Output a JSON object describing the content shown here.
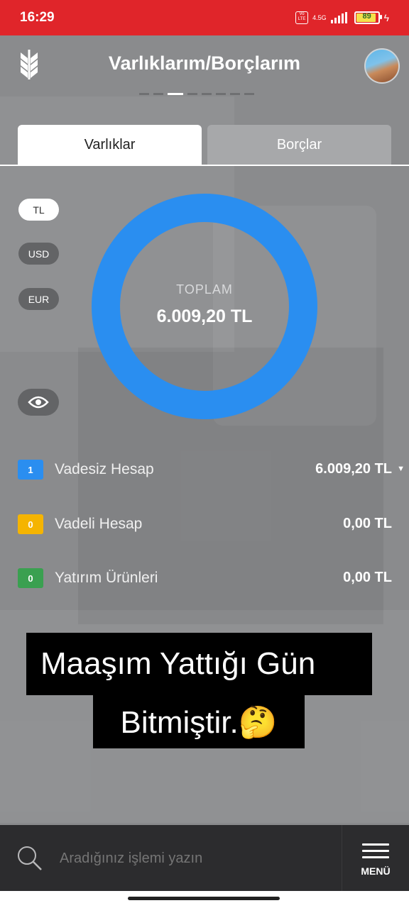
{
  "status_bar": {
    "time": "16:29",
    "network": "4.5G",
    "volte": "VoLTE",
    "battery": "89"
  },
  "header": {
    "title": "Varlıklarım/Borçlarım",
    "pager_count": 8,
    "pager_active": 2
  },
  "tabs": [
    {
      "label": "Varlıklar",
      "active": true
    },
    {
      "label": "Borçlar",
      "active": false
    }
  ],
  "currencies": [
    {
      "label": "TL",
      "selected": true
    },
    {
      "label": "USD",
      "selected": false
    },
    {
      "label": "EUR",
      "selected": false
    }
  ],
  "summary": {
    "label": "TOPLAM",
    "value": "6.009,20 TL",
    "ring_color": "#2a8ef0"
  },
  "assets": [
    {
      "badge": "1",
      "name": "Vadesiz Hesap",
      "amount": "6.009,20 TL",
      "color": "#2a8ef0",
      "expandable": true
    },
    {
      "badge": "0",
      "name": "Vadeli Hesap",
      "amount": "0,00 TL",
      "color": "#f5b400",
      "expandable": false
    },
    {
      "badge": "0",
      "name": "Yatırım Ürünleri",
      "amount": "0,00 TL",
      "color": "#3aa050",
      "expandable": false
    }
  ],
  "caption": {
    "line1": "Maaşım Yattığı Gün",
    "line2": "Bitmiştir.🤔"
  },
  "bottom_bar": {
    "search_placeholder": "Aradığınız işlemi yazın",
    "menu_label": "MENÜ"
  },
  "colors": {
    "status_bar": "#e0252a",
    "background": "#8a8b8d",
    "accent": "#2a8ef0"
  }
}
